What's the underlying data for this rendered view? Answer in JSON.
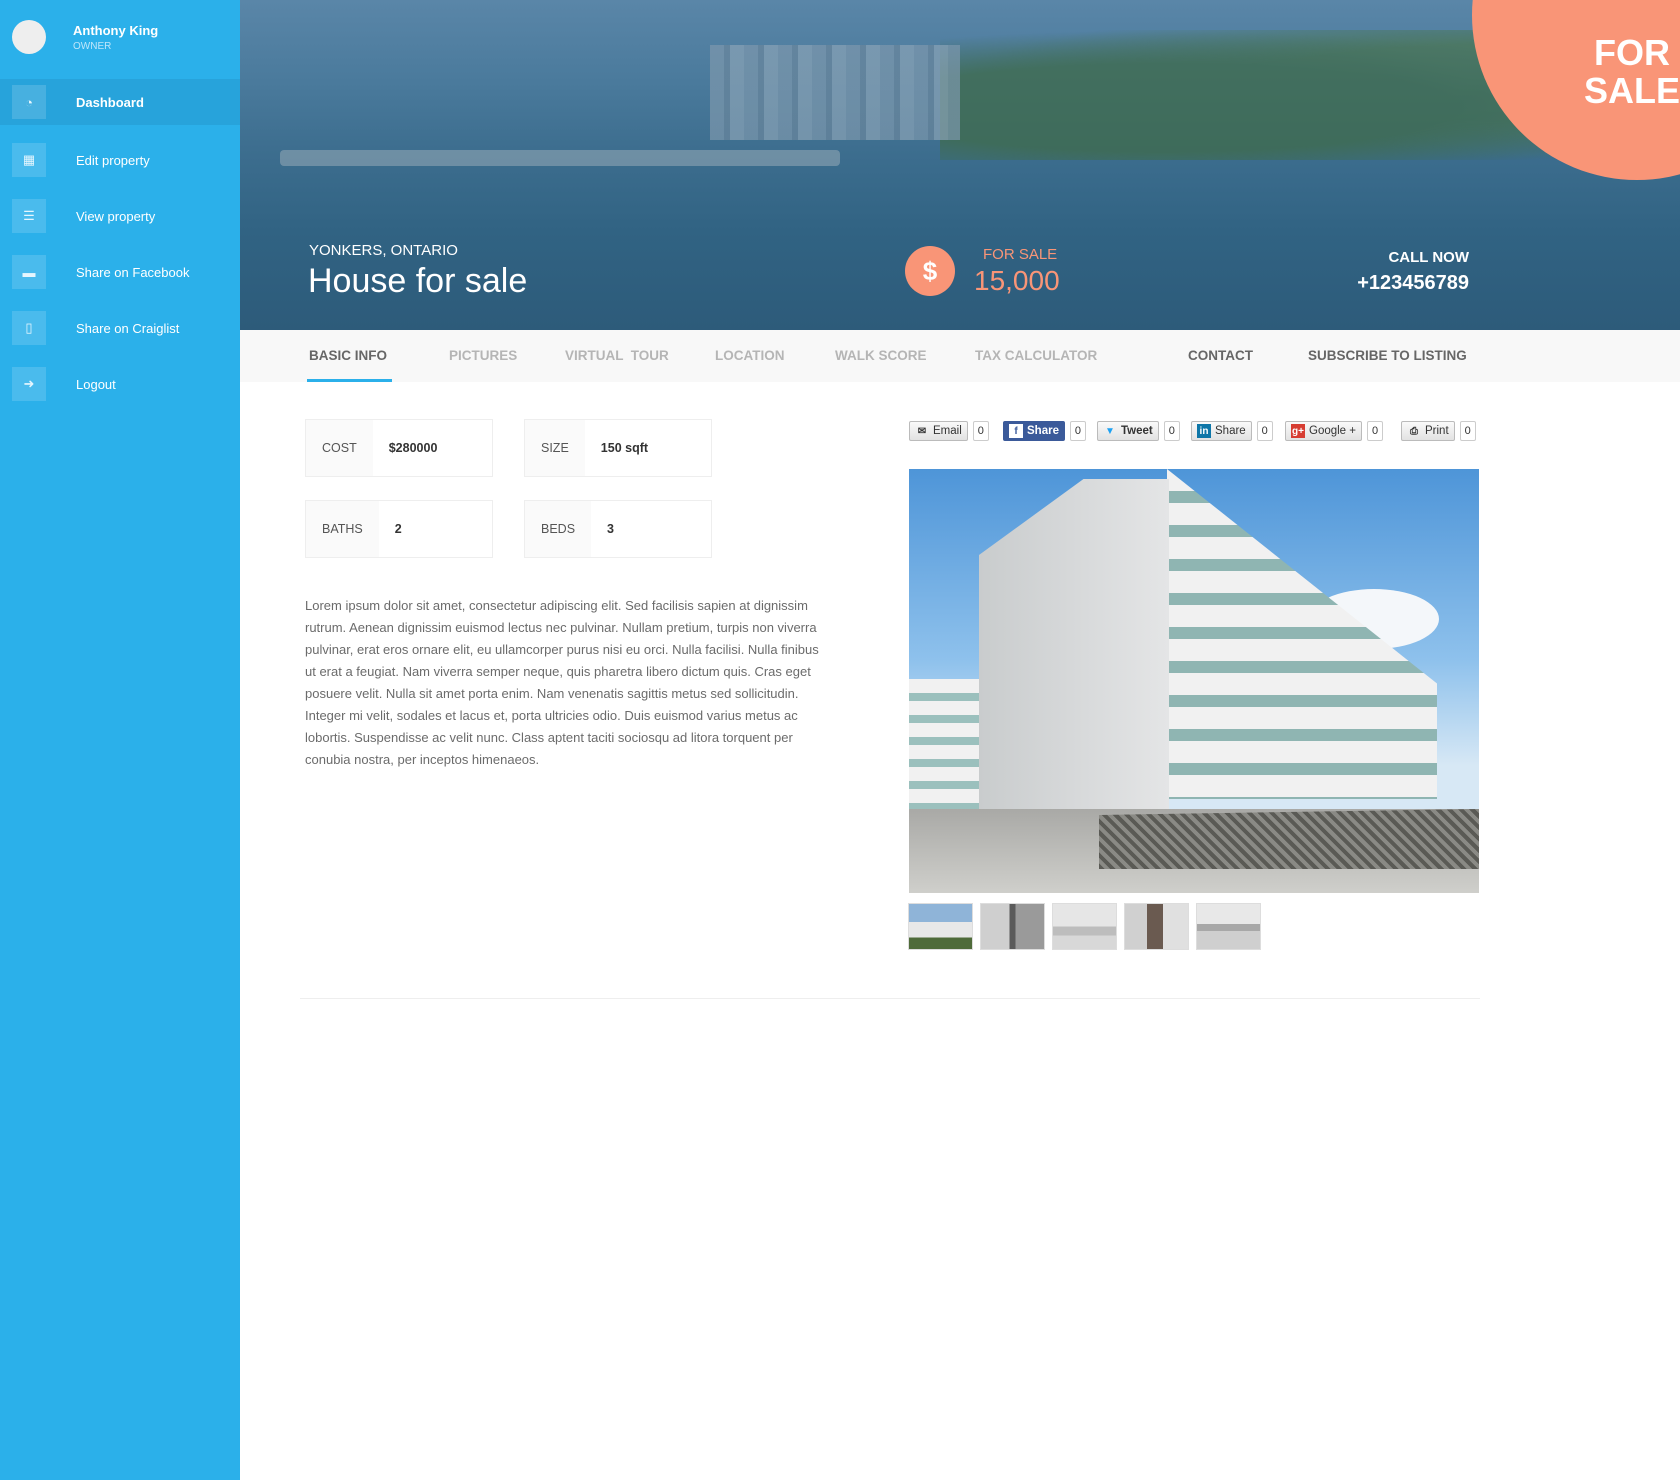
{
  "user": {
    "name": "Anthony King",
    "role": "OWNER"
  },
  "sidebar": {
    "items": [
      {
        "label": "Dashboard",
        "icon": "dashboard-icon",
        "glyph": "◔",
        "active": true
      },
      {
        "label": "Edit property",
        "icon": "building-icon",
        "glyph": "▦"
      },
      {
        "label": "View property",
        "icon": "list-icon",
        "glyph": "☰"
      },
      {
        "label": "Share on Facebook",
        "icon": "briefcase-icon",
        "glyph": "▬"
      },
      {
        "label": "Share on Craiglist",
        "icon": "file-icon",
        "glyph": "▯"
      },
      {
        "label": "Logout",
        "icon": "sign-out-icon",
        "glyph": "➜"
      }
    ]
  },
  "hero": {
    "location": "YONKERS, ONTARIO",
    "title": "House for sale",
    "dollar_glyph": "$",
    "sale_label": "FOR SALE",
    "price": "15,000",
    "call_label": "CALL NOW",
    "phone": "+123456789",
    "corner_line1": "FOR",
    "corner_line2": "SALE",
    "accent": "#f99577"
  },
  "tabs": [
    {
      "label": "BASIC INFO",
      "active": true
    },
    {
      "label": "PICTURES"
    },
    {
      "label": "VIRTUAL  TOUR"
    },
    {
      "label": "LOCATION"
    },
    {
      "label": "WALK SCORE"
    },
    {
      "label": "TAX CALCULATOR"
    },
    {
      "label": "CONTACT"
    },
    {
      "label": "SUBSCRIBE TO LISTING"
    }
  ],
  "stats": [
    {
      "label": "COST",
      "value": "$280000"
    },
    {
      "label": "SIZE",
      "value": "150 sqft"
    },
    {
      "label": "BATHS",
      "value": "2"
    },
    {
      "label": "BEDS",
      "value": "3"
    }
  ],
  "description": "Lorem ipsum dolor sit amet, consectetur adipiscing elit. Sed facilisis sapien at dignissim rutrum. Aenean dignissim euismod lectus nec pulvinar. Nullam pretium, turpis non viverra pulvinar, erat eros ornare elit, eu ullamcorper purus nisi eu orci. Nulla facilisi. Nulla finibus ut erat a feugiat. Nam viverra semper neque, quis pharetra libero dictum quis. Cras eget posuere velit. Nulla sit amet porta enim. Nam venenatis sagittis metus sed sollicitudin. Integer mi velit, sodales et lacus et, porta ultricies odio. Duis euismod varius metus ac lobortis. Suspendisse ac velit nunc. Class aptent taciti sociosqu ad litora torquent per conubia nostra, per inceptos himenaeos.",
  "share": [
    {
      "label": "Email",
      "count": "0",
      "icon": "email-icon",
      "glyph": "✉"
    },
    {
      "label": "Share",
      "count": "0",
      "icon": "facebook-icon",
      "glyph": "f"
    },
    {
      "label": "Tweet",
      "count": "0",
      "icon": "twitter-icon",
      "glyph": "🐦"
    },
    {
      "label": "Share",
      "count": "0",
      "icon": "linkedin-icon",
      "glyph": "in"
    },
    {
      "label": "Google +",
      "count": "0",
      "icon": "google-plus-icon",
      "glyph": "g+"
    },
    {
      "label": "Print",
      "count": "0",
      "icon": "print-icon",
      "glyph": "⎙"
    }
  ]
}
